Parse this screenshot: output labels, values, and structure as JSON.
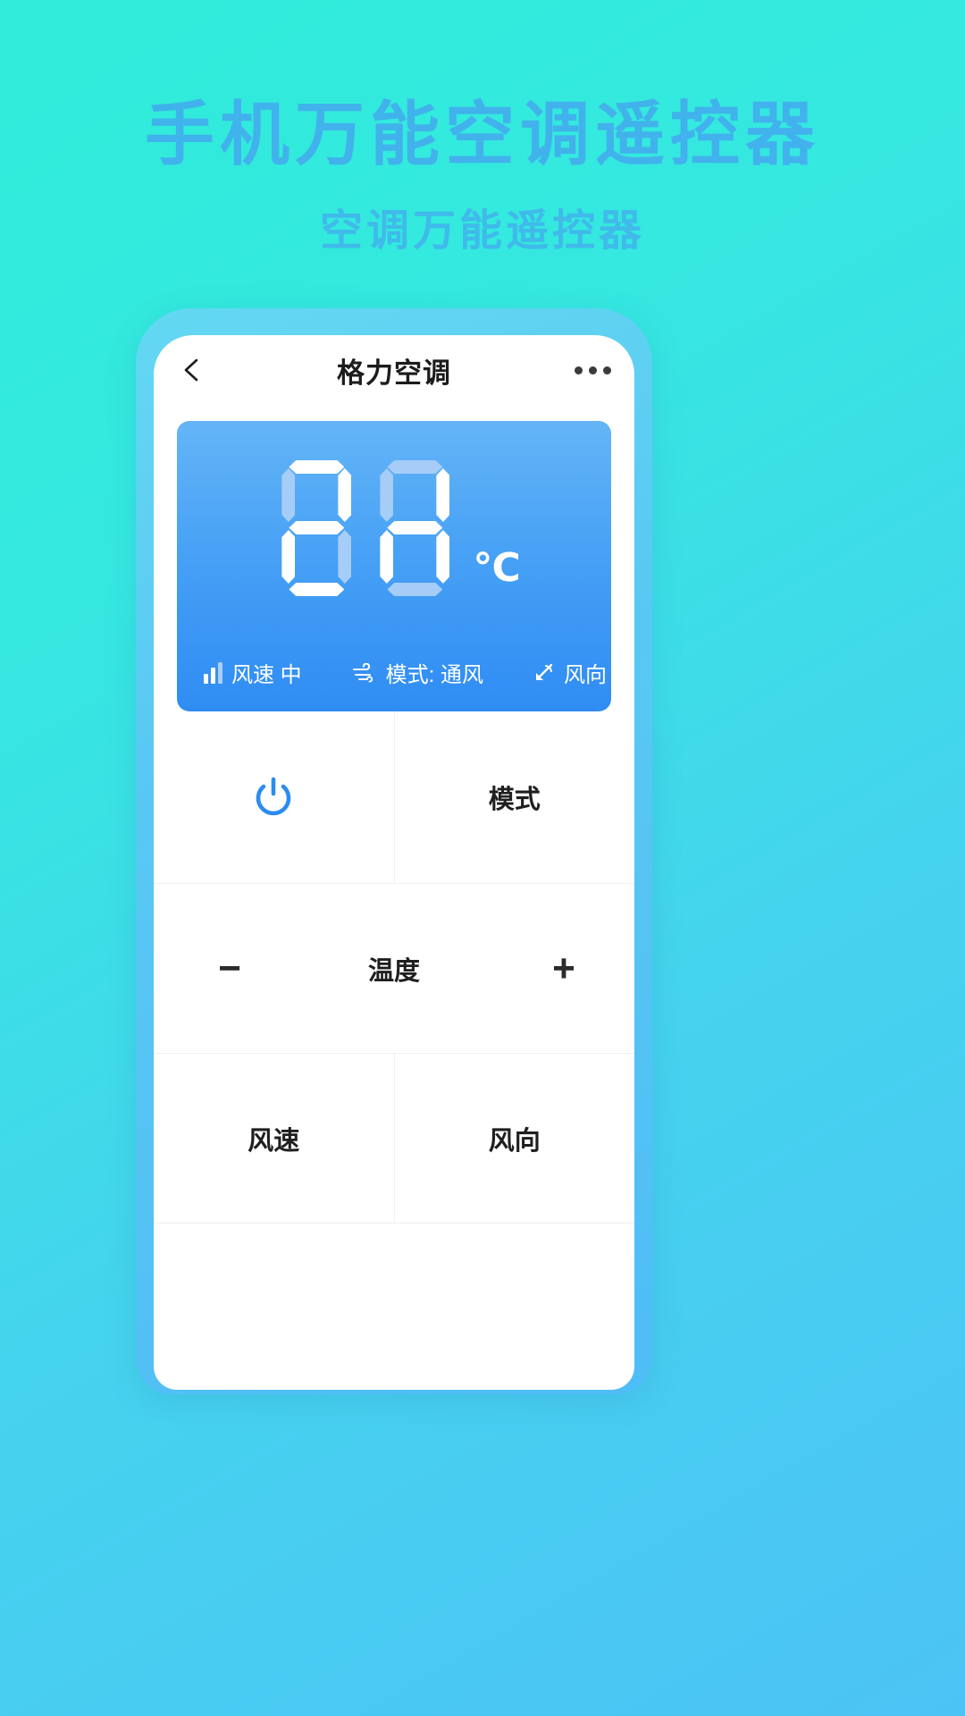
{
  "promo": {
    "title": "手机万能空调遥控器",
    "subtitle": "空调万能遥控器",
    "title_color": "#4a90f5",
    "bg_from": "#2fecd9",
    "bg_to": "#4cc3f5"
  },
  "app": {
    "header": {
      "back_icon": "chevron-left-icon",
      "title": "格力空调",
      "more_icon": "more-horizontal-icon"
    },
    "display": {
      "temperature": "88",
      "digit_left": "8",
      "digit_right": "8",
      "unit": "℃",
      "panel_color_top": "#64b5f7",
      "panel_color_bottom": "#2f8cf3",
      "status": [
        {
          "icon": "fan-speed-bars-icon",
          "label": "风速 中"
        },
        {
          "icon": "wind-mode-icon",
          "label": "模式: 通风"
        },
        {
          "icon": "wind-direction-icon",
          "label": "风向 上"
        }
      ]
    },
    "controls": {
      "power": {
        "icon": "power-icon",
        "label": "",
        "color": "#2b8cf0"
      },
      "mode": {
        "label": "模式"
      },
      "temperature": {
        "decrease": "−",
        "label": "温度",
        "increase": "+"
      },
      "fan_speed": {
        "label": "风速"
      },
      "wind_direction": {
        "label": "风向"
      }
    }
  }
}
